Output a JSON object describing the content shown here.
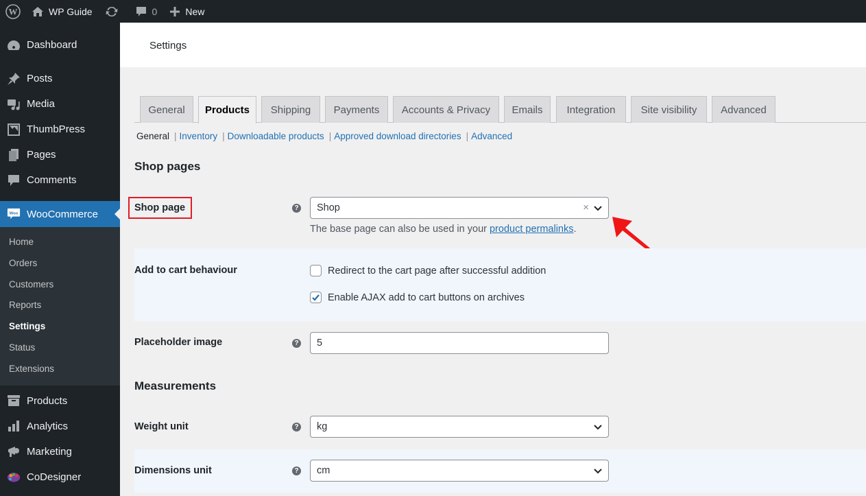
{
  "adminbar": {
    "site_name": "WP Guide",
    "comments_count": "0",
    "new_label": "New"
  },
  "sidebar": {
    "items_top": [
      {
        "label": "Dashboard",
        "icon": "dashboard-icon"
      },
      {
        "label": "Posts",
        "icon": "pin-icon"
      },
      {
        "label": "Media",
        "icon": "media-icon"
      },
      {
        "label": "ThumbPress",
        "icon": "image-icon"
      },
      {
        "label": "Pages",
        "icon": "pages-icon"
      },
      {
        "label": "Comments",
        "icon": "comment-icon"
      }
    ],
    "active": {
      "label": "WooCommerce",
      "icon": "woo-icon"
    },
    "submenu": [
      "Home",
      "Orders",
      "Customers",
      "Reports",
      "Settings",
      "Status",
      "Extensions"
    ],
    "submenu_current": "Settings",
    "items_bottom": [
      {
        "label": "Products",
        "icon": "archive-icon"
      },
      {
        "label": "Analytics",
        "icon": "bar-chart-icon"
      },
      {
        "label": "Marketing",
        "icon": "megaphone-icon"
      },
      {
        "label": "CoDesigner",
        "icon": "palette-icon"
      }
    ]
  },
  "header": {
    "title": "Settings"
  },
  "tabs": [
    "General",
    "Products",
    "Shipping",
    "Payments",
    "Accounts & Privacy",
    "Emails",
    "Integration",
    "Site visibility",
    "Advanced"
  ],
  "active_tab": "Products",
  "subsections": {
    "current": "General",
    "links": [
      "Inventory",
      "Downloadable products",
      "Approved download directories",
      "Advanced"
    ]
  },
  "shop_pages": {
    "title": "Shop pages",
    "shop_page": {
      "label": "Shop page",
      "value": "Shop",
      "clear": "×",
      "desc_prefix": "The base page can also be used in your ",
      "desc_link": "product permalinks",
      "desc_suffix": "."
    },
    "add_to_cart": {
      "label": "Add to cart behaviour",
      "options": [
        {
          "label": "Redirect to the cart page after successful addition",
          "checked": false
        },
        {
          "label": "Enable AJAX add to cart buttons on archives",
          "checked": true
        }
      ]
    },
    "placeholder_image": {
      "label": "Placeholder image",
      "value": "5"
    }
  },
  "measurements": {
    "title": "Measurements",
    "weight_unit": {
      "label": "Weight unit",
      "value": "kg"
    },
    "dimensions_unit": {
      "label": "Dimensions unit",
      "value": "cm"
    }
  },
  "help_glyph": "?",
  "colors": {
    "accent": "#2271b1",
    "adminbar": "#1d2327",
    "annotation": "#e31b23"
  }
}
